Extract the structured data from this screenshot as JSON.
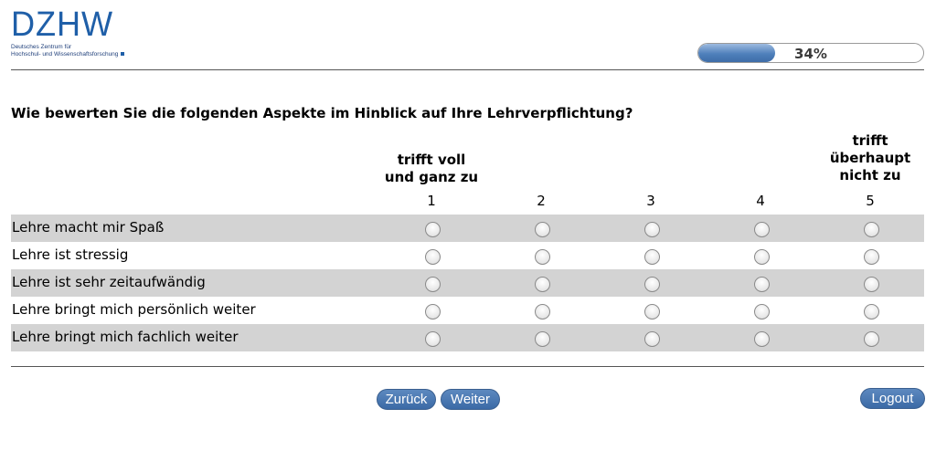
{
  "logo": {
    "wordmark": "DZHW",
    "subtitle_line1": "Deutsches Zentrum für",
    "subtitle_line2": "Hochschul- und Wissenschaftsforschung"
  },
  "progress": {
    "percent": 34,
    "label": "34%"
  },
  "question": "Wie bewerten Sie die folgenden Aspekte im Hinblick auf Ihre Lehrverpflichtung?",
  "scale": {
    "left_label_line1": "trifft voll",
    "left_label_line2": "und ganz zu",
    "right_label_line1": "trifft",
    "right_label_line2": "überhaupt",
    "right_label_line3": "nicht zu",
    "points": [
      "1",
      "2",
      "3",
      "4",
      "5"
    ]
  },
  "items": [
    {
      "label": "Lehre macht mir Spaß"
    },
    {
      "label": "Lehre ist stressig"
    },
    {
      "label": "Lehre ist sehr zeitaufwändig"
    },
    {
      "label": "Lehre bringt mich persönlich weiter"
    },
    {
      "label": "Lehre bringt mich fachlich weiter"
    }
  ],
  "nav": {
    "back_label": "Zurück",
    "next_label": "Weiter",
    "logout_label": "Logout"
  },
  "colors": {
    "brand": "#1f5fa8",
    "button": "#3b6aa6",
    "row_shade": "#d3d3d3"
  }
}
